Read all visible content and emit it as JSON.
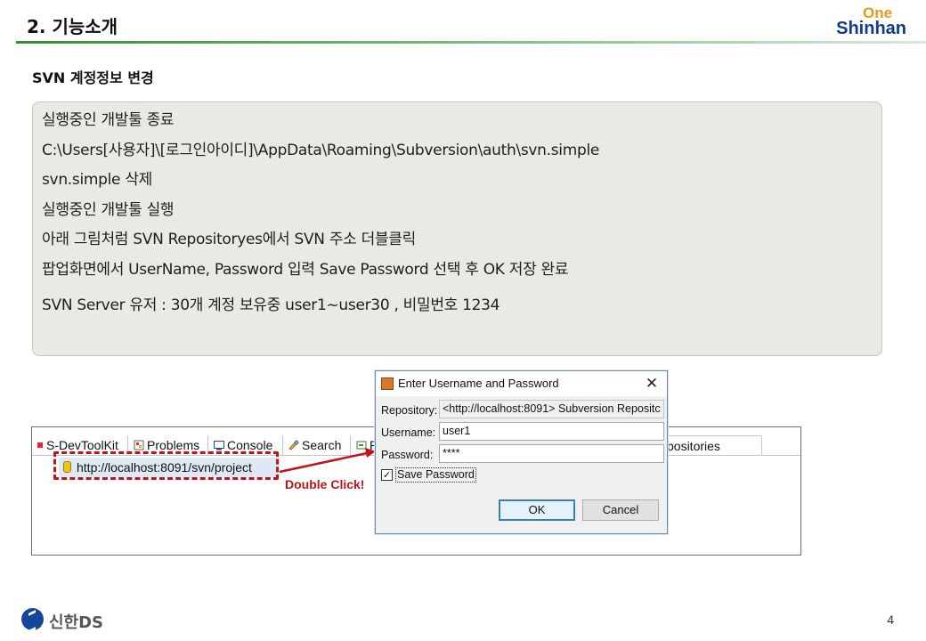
{
  "header": {
    "title": "2. 기능소개",
    "logo_top": "One",
    "logo_bottom": "Shinhan"
  },
  "section_title": "SVN 계정정보 변경",
  "instructions": [
    "실행중인 개발툴 종료",
    "C:\\Users[사용자]\\[로그인아이디]\\AppData\\Roaming\\Subversion\\auth\\svn.simple",
    "svn.simple 삭제",
    "실행중인 개발툴 실행",
    "아래 그림처럼 SVN Repositoryes에서 SVN 주소 더블클릭",
    "팝업화면에서 UserName, Password 입력 Save Password 선택 후 OK 저장 완료",
    "SVN Server 유저 :  30개 계정 보유중 user1~user30 , 비밀번호 1234"
  ],
  "eclipse": {
    "tabs": [
      "S-DevToolKit",
      "Problems",
      "Console",
      "Search",
      "P"
    ],
    "tab_rest": "positories",
    "repo_url": "http://localhost:8091/svn/project",
    "annotation": "Double Click!"
  },
  "dialog": {
    "title": "Enter Username and Password",
    "repository_label": "Repository:",
    "repository_value": "<http://localhost:8091> Subversion Repositc",
    "username_label": "Username:",
    "username_value": "user1",
    "password_label": "Password:",
    "password_value": "****",
    "save_password_label": "Save Password",
    "save_password_checked": true,
    "ok_label": "OK",
    "cancel_label": "Cancel"
  },
  "footer": {
    "brand": "신한DS",
    "page_number": "4"
  },
  "colors": {
    "accent_green": "#3a8a3a",
    "annotation_red": "#c0141c",
    "brand_blue": "#123a8c",
    "brand_orange": "#e39a1a"
  }
}
